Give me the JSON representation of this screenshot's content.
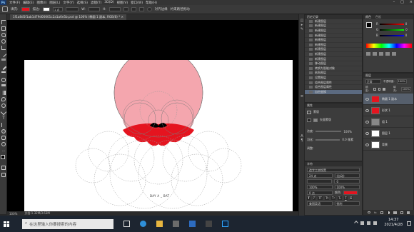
{
  "menubar": {
    "logo": "Ps",
    "items": [
      "文件(F)",
      "编辑(E)",
      "图像(I)",
      "图层(L)",
      "文字(Y)",
      "选择(S)",
      "滤镜(T)",
      "3D(D)",
      "视图(V)",
      "窗口(W)",
      "帮助(H)"
    ],
    "window_controls": [
      "–",
      "□",
      "×"
    ]
  },
  "options_bar": {
    "fill_label": "填充:",
    "stroke_label": "描边:",
    "stroke_width": "1 点",
    "w_label": "W:",
    "h_label": "H:",
    "align_edges": "对齐边缘",
    "constrain": "约束路径拖动"
  },
  "document_tab": {
    "title": "1f1a8d5f1ab1d79d00001c2a1a6e5b.psd @ 100% (椭圆 1 副本, RGB/8) *"
  },
  "canvas": {
    "text": "DAY A _ BAT",
    "colors": {
      "pink": "#F4A6AE",
      "red": "#E5141F",
      "black": "#000000"
    }
  },
  "status_bar": {
    "zoom": "100%",
    "doc": "文档:1.32M/3.63M"
  },
  "history_panel": {
    "title": "历史记录",
    "items": [
      "新建图层",
      "新建图层",
      "新建图层",
      "新建图层",
      "新建图层",
      "新建图层",
      "新建图层",
      "新建图层",
      "新建图层",
      "移动图层",
      "转换为智能对象",
      "粘贴图层",
      "设置图层",
      "组合图层属性",
      "组合图层属性",
      "自由变换"
    ],
    "selected_index": 15
  },
  "color_panel": {
    "title": "颜色",
    "swatches_title": "色板",
    "channels": [
      "R",
      "G",
      "B"
    ],
    "values": [
      "0",
      "0",
      "0"
    ],
    "fg_color": "#000000",
    "bg_color": "#ffffff"
  },
  "properties_panel": {
    "title": "属性",
    "subtitle": "蒙版",
    "mask_label": "矢量蒙版",
    "density_label": "浓度:",
    "density_value": "100%",
    "feather_label": "羽化:",
    "feather_value": "0.0 像素",
    "refine_label": "调整:"
  },
  "character_panel": {
    "title": "字符",
    "font": "造字工房悦黑",
    "size": "24 点",
    "leading": "(自动)",
    "tracking": "0",
    "scale_v": "100%",
    "scale_h": "100%",
    "baseline": "0 点",
    "color_label": "颜色:",
    "color_value": "#E5141F",
    "language": "美国英语",
    "aa": "锐利"
  },
  "layers_panel": {
    "title": "图层",
    "mode": "正常",
    "opacity_label": "不透明度:",
    "opacity": "100%",
    "fill_label": "填充:",
    "fill": "100%",
    "lock_label": "锁定:",
    "layers": [
      {
        "name": "椭圆 1 副本",
        "thumb": "#E5141F",
        "selected": true
      },
      {
        "name": "形状 1",
        "thumb": "#E5141F",
        "selected": false
      },
      {
        "name": "组 1",
        "thumb": "#888888",
        "selected": false
      },
      {
        "name": "图层 1",
        "thumb": "#ffffff",
        "selected": false
      },
      {
        "name": "背景",
        "thumb": "#ffffff",
        "selected": false
      }
    ]
  },
  "taskbar": {
    "search_placeholder": "在这里输入你要搜索的内容",
    "time": "14:37",
    "date": "2021/4/28"
  }
}
